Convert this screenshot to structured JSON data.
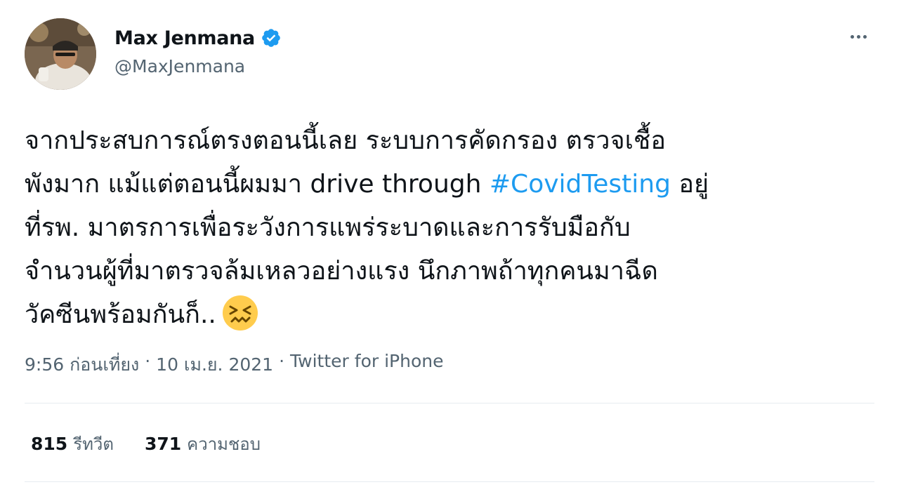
{
  "author": {
    "display_name": "Max Jenmana",
    "handle": "@MaxJenmana",
    "verified": true
  },
  "tweet": {
    "lines": [
      {
        "before": "จากประสบการณ์ตรงตอนนี้เลย ระบบการคัดกรอง ตรวจเชื้อ",
        "hashtag": "",
        "after": ""
      },
      {
        "before": "พังมาก แม้แต่ตอนนี้ผมมา drive through ",
        "hashtag": "#CovidTesting",
        "after": " อยู่"
      },
      {
        "before": "ที่รพ. มาตรการเพื่อระวังการแพร่ระบาดและการรับมือกับ",
        "hashtag": "",
        "after": ""
      },
      {
        "before": "จำนวนผู้ที่มาตรวจล้มเหลวอย่างแรง นึกภาพถ้าทุกคนมาฉีด",
        "hashtag": "",
        "after": ""
      },
      {
        "before": "วัคซีนพร้อมกันก็..",
        "hashtag": "",
        "after": ""
      }
    ],
    "emoji": "confounded-face"
  },
  "meta": {
    "time": "9:56 ก่อนเที่ยง",
    "separator": "·",
    "date": "10 เม.ย. 2021",
    "source": "Twitter for iPhone"
  },
  "stats": {
    "retweets_count": "815",
    "retweets_label": "รีทวีต",
    "likes_count": "371",
    "likes_label": "ความชอบ"
  },
  "colors": {
    "link": "#1d9bf0",
    "secondary_text": "#536471",
    "primary_text": "#0f1419",
    "divider": "#e6ecf0"
  }
}
